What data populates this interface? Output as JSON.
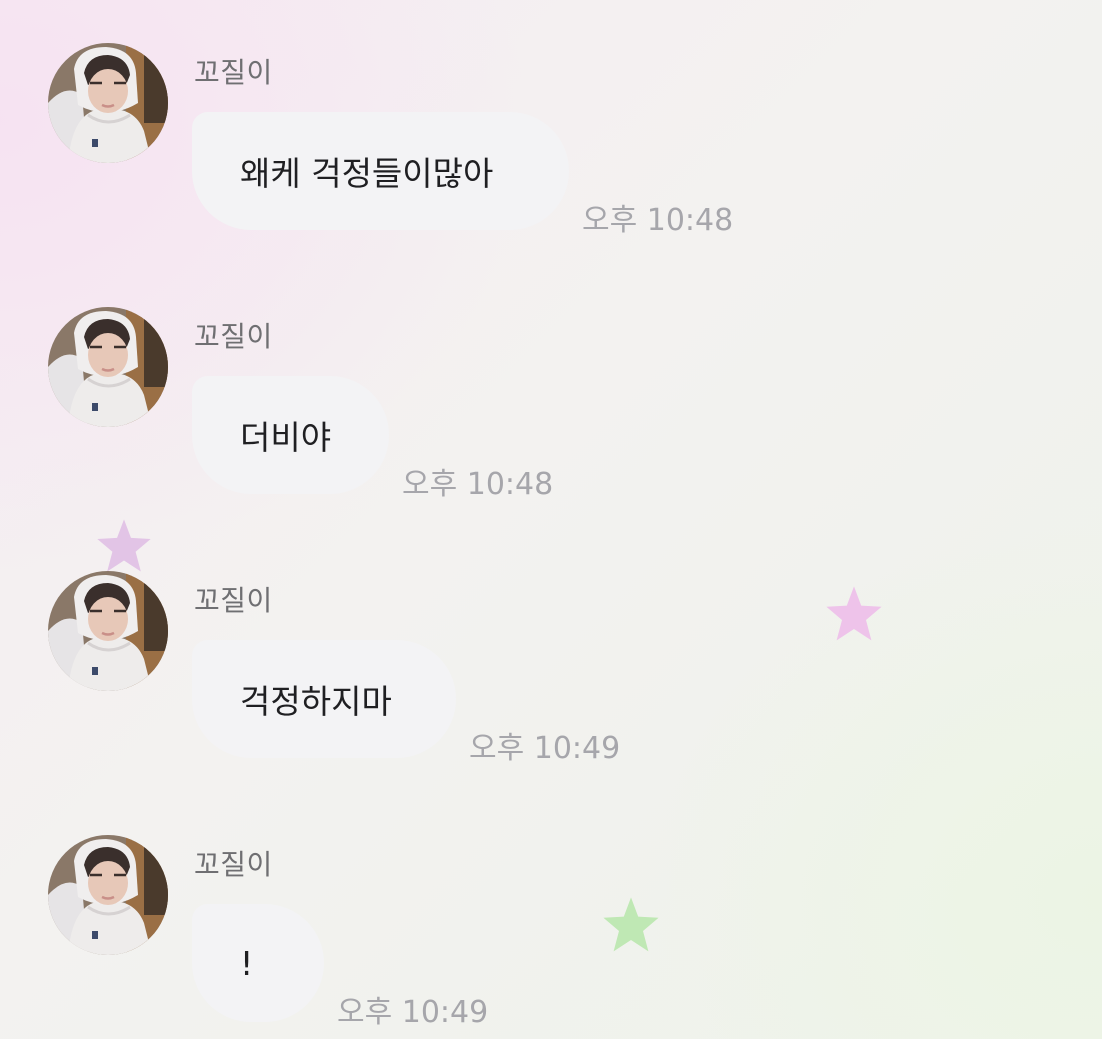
{
  "chat": {
    "messages": [
      {
        "sender": "꼬질이",
        "text": "왜케 걱정들이많아",
        "time": "오후 10:48"
      },
      {
        "sender": "꼬질이",
        "text": "더비야",
        "time": "오후 10:48"
      },
      {
        "sender": "꼬질이",
        "text": "걱정하지마",
        "time": "오후 10:49"
      },
      {
        "sender": "꼬질이",
        "text": "!",
        "time": "오후 10:49"
      }
    ]
  },
  "decorations": {
    "stars": [
      {
        "color": "#e2c4e6"
      },
      {
        "color": "#eec3ea"
      },
      {
        "color": "#bfe8b4"
      }
    ]
  },
  "colors": {
    "bubble": "#f3f3f5",
    "sender_text": "#6f6f72",
    "time_text": "#a6a6ab",
    "message_text": "#1f1f22"
  }
}
